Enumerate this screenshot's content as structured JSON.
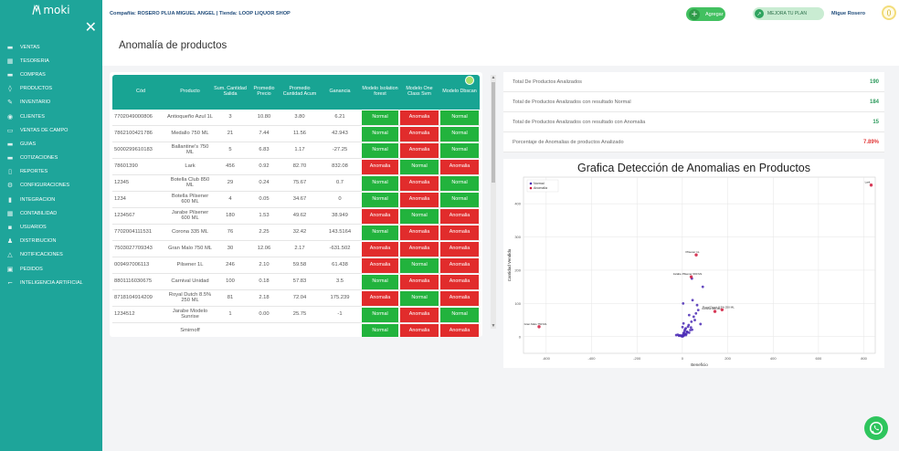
{
  "brand": {
    "logo_text": "moki"
  },
  "sidebar": {
    "close": "✕",
    "items": [
      {
        "label": "VENTAS",
        "icon": "cash-register-icon",
        "glyph": "▬"
      },
      {
        "label": "TESORERIA",
        "icon": "treasury-icon",
        "glyph": "▦"
      },
      {
        "label": "COMPRAS",
        "icon": "shopping-icon",
        "glyph": "▬"
      },
      {
        "label": "PRODUCTOS",
        "icon": "products-icon",
        "glyph": "◊"
      },
      {
        "label": "INVENTARIO",
        "icon": "inventory-icon",
        "glyph": "✎"
      },
      {
        "label": "CLIENTES",
        "icon": "clients-icon",
        "glyph": "◉"
      },
      {
        "label": "VENTAS DE CAMPO",
        "icon": "field-sales-icon",
        "glyph": "▭"
      },
      {
        "label": "GUIAS",
        "icon": "guides-icon",
        "glyph": "▬"
      },
      {
        "label": "COTIZACIONES",
        "icon": "quotes-icon",
        "glyph": "▬"
      },
      {
        "label": "REPORTES",
        "icon": "reports-icon",
        "glyph": "▯"
      },
      {
        "label": "CONFIGURACIONES",
        "icon": "settings-icon",
        "glyph": "⚙"
      },
      {
        "label": "INTEGRACION",
        "icon": "integration-icon",
        "glyph": "▮"
      },
      {
        "label": "CONTABILIDAD",
        "icon": "accounting-icon",
        "glyph": "▦"
      },
      {
        "label": "USUARIOS",
        "icon": "users-icon",
        "glyph": "▪"
      },
      {
        "label": "DISTRIBUCION",
        "icon": "distribution-icon",
        "glyph": "♟"
      },
      {
        "label": "NOTIFICACIONES",
        "icon": "notifications-icon",
        "glyph": "△"
      },
      {
        "label": "PEDIDOS",
        "icon": "orders-icon",
        "glyph": "▣"
      },
      {
        "label": "INTELIGENCIA ARTIFICIAL",
        "icon": "ai-icon",
        "glyph": "⌐"
      }
    ]
  },
  "header": {
    "company_line": "Compañia: ROSERO PLUA MIGUEL ANGEL | Tienda: LOOP LIQUOR SHOP",
    "add_button": "Agregar",
    "plan_button": "MEJORA TU PLAN",
    "user_name": "Migue Rosero",
    "user_initial": "()"
  },
  "page": {
    "title": "Anomalía de productos"
  },
  "table": {
    "columns": [
      "Cód",
      "Producto",
      "Sum. Cantidad Salida",
      "Promedio Precio",
      "Promedio Cantidad Acum",
      "Ganancia",
      "Modelo Isolation forest",
      "Modelo One Class Svm",
      "Modelo Dbscan"
    ],
    "rows": [
      {
        "cod": "7702049000806",
        "producto": "Antioqueño Azul 1L",
        "salida": "3",
        "precio": "10.80",
        "acum": "3.80",
        "ganancia": "6.21",
        "iso": "Normal",
        "svm": "Anomalia",
        "dbscan": "Normal"
      },
      {
        "cod": "7862100421786",
        "producto": "Medallo 750 ML",
        "salida": "21",
        "precio": "7.44",
        "acum": "11.56",
        "ganancia": "42.943",
        "iso": "Normal",
        "svm": "Anomalia",
        "dbscan": "Normal"
      },
      {
        "cod": "5000299610183",
        "producto": "Ballantine's 750 ML",
        "salida": "5",
        "precio": "6.83",
        "acum": "1.17",
        "ganancia": "-27.25",
        "iso": "Normal",
        "svm": "Anomalia",
        "dbscan": "Normal"
      },
      {
        "cod": "78601390",
        "producto": "Lark",
        "salida": "456",
        "precio": "0.92",
        "acum": "82.70",
        "ganancia": "832.08",
        "iso": "Anomalia",
        "svm": "Normal",
        "dbscan": "Anomalia"
      },
      {
        "cod": "12345",
        "producto": "Botella Club 850 ML",
        "salida": "29",
        "precio": "0.24",
        "acum": "75.67",
        "ganancia": "0.7",
        "iso": "Normal",
        "svm": "Anomalia",
        "dbscan": "Normal"
      },
      {
        "cod": "1234",
        "producto": "Botella Pilsener 600 ML",
        "salida": "4",
        "precio": "0.05",
        "acum": "34.67",
        "ganancia": "0",
        "iso": "Normal",
        "svm": "Anomalia",
        "dbscan": "Normal"
      },
      {
        "cod": "1234567",
        "producto": "Jarabe Pilsener 600 ML",
        "salida": "180",
        "precio": "1.53",
        "acum": "49.62",
        "ganancia": "38.949",
        "iso": "Anomalia",
        "svm": "Normal",
        "dbscan": "Anomalia"
      },
      {
        "cod": "7702004111531",
        "producto": "Corona 335 ML",
        "salida": "76",
        "precio": "2.25",
        "acum": "32.42",
        "ganancia": "143.5164",
        "iso": "Normal",
        "svm": "Anomalia",
        "dbscan": "Anomalia"
      },
      {
        "cod": "7503027709343",
        "producto": "Gran Malo 750 ML",
        "salida": "30",
        "precio": "12.06",
        "acum": "2.17",
        "ganancia": "-631.502",
        "iso": "Anomalia",
        "svm": "Anomalia",
        "dbscan": "Anomalia"
      },
      {
        "cod": "009497006113",
        "producto": "Pilsener 1L",
        "salida": "246",
        "precio": "2.10",
        "acum": "59.58",
        "ganancia": "61.438",
        "iso": "Anomalia",
        "svm": "Normal",
        "dbscan": "Anomalia"
      },
      {
        "cod": "8801116030675",
        "producto": "Carnival Unidad",
        "salida": "100",
        "precio": "0.18",
        "acum": "57.83",
        "ganancia": "3.5",
        "iso": "Normal",
        "svm": "Anomalia",
        "dbscan": "Anomalia"
      },
      {
        "cod": "8718104914209",
        "producto": "Royal Dutch 8.5% 250 ML",
        "salida": "81",
        "precio": "2.18",
        "acum": "72.04",
        "ganancia": "175.239",
        "iso": "Anomalia",
        "svm": "Normal",
        "dbscan": "Anomalia"
      },
      {
        "cod": "1234512",
        "producto": "Jarabe Modelo Sunrise",
        "salida": "1",
        "precio": "0.00",
        "acum": "25.75",
        "ganancia": "-1",
        "iso": "Normal",
        "svm": "Anomalia",
        "dbscan": "Normal"
      },
      {
        "cod": "",
        "producto": "Smirnoff",
        "salida": "",
        "precio": "",
        "acum": "",
        "ganancia": "",
        "iso": "Normal",
        "svm": "Anomalia",
        "dbscan": "Anomalia"
      }
    ]
  },
  "stats": [
    {
      "label": "Total De Productos Analizados",
      "value": "190",
      "color": "#2e9b5d"
    },
    {
      "label": "Total de Productos Analizados con resultado Normal",
      "value": "184",
      "color": "#2e9b5d"
    },
    {
      "label": "Total de Productos Analizados con resultado con Anomalia",
      "value": "15",
      "color": "#2e9b5d"
    },
    {
      "label": "Porcentaje de Anomalias de productos Analizado",
      "value": "7.89%",
      "color": "#e23b3b"
    }
  ],
  "colors": {
    "sidebar": "#1ea59a",
    "table_header": "#18a493",
    "normal": "#22b33d",
    "anomalia": "#e12c2c",
    "point_normal": "#4b2bb5",
    "point_anomalia": "#d0193c"
  },
  "chart_data": {
    "type": "scatter",
    "title": "Grafica Detección de Anomalias en Productos",
    "xlabel": "Beneficio",
    "ylabel": "Cantidad Vendida",
    "xlim": [
      -700,
      850
    ],
    "ylim": [
      -50,
      480
    ],
    "x_ticks": [
      "-600",
      "-400",
      "-200",
      "0",
      "200",
      "400",
      "600",
      "800"
    ],
    "y_ticks": [
      "0",
      "100",
      "200",
      "300",
      "400"
    ],
    "grid": true,
    "legend": "top-left",
    "series": [
      {
        "name": "Normal",
        "points": [
          [
            6,
            3
          ],
          [
            43,
            21
          ],
          [
            -27,
            5
          ],
          [
            0.7,
            29
          ],
          [
            0,
            4
          ],
          [
            3.5,
            100
          ],
          [
            -1,
            1
          ],
          [
            5,
            10
          ],
          [
            12,
            8
          ],
          [
            -5,
            2
          ],
          [
            20,
            15
          ],
          [
            30,
            12
          ],
          [
            8,
            6
          ],
          [
            15,
            25
          ],
          [
            -10,
            4
          ],
          [
            25,
            30
          ],
          [
            10,
            18
          ],
          [
            40,
            45
          ],
          [
            2,
            1
          ],
          [
            18,
            9
          ],
          [
            50,
            60
          ],
          [
            35,
            20
          ],
          [
            -15,
            3
          ],
          [
            60,
            70
          ],
          [
            22,
            14
          ],
          [
            5,
            40
          ],
          [
            45,
            110
          ],
          [
            28,
            35
          ],
          [
            12,
            22
          ],
          [
            55,
            50
          ],
          [
            -20,
            6
          ],
          [
            38,
            28
          ],
          [
            7,
            12
          ],
          [
            16,
            5
          ],
          [
            70,
            80
          ],
          [
            90,
            150
          ],
          [
            42,
            175
          ],
          [
            30,
            65
          ],
          [
            65,
            95
          ],
          [
            80,
            38
          ]
        ]
      },
      {
        "name": "Anomalia",
        "points": [
          [
            832,
            456
          ],
          [
            39,
            180
          ],
          [
            143.5,
            76
          ],
          [
            -631.5,
            30
          ],
          [
            61,
            246
          ],
          [
            175,
            81
          ]
        ]
      }
    ],
    "annotations": [
      {
        "text": "Lark",
        "x": 832,
        "y": 456
      },
      {
        "text": "Pilsener 1L",
        "x": 61,
        "y": 246
      },
      {
        "text": "Gran Malo 750 ML",
        "x": -631.5,
        "y": 30
      },
      {
        "text": "Royal Dutch 8.5% 250 ML",
        "x": 175,
        "y": 81
      },
      {
        "text": "Jarabe Pilsener 600 ML",
        "x": 39,
        "y": 180
      },
      {
        "text": "Corona 335 ML",
        "x": 143.5,
        "y": 76
      }
    ]
  }
}
